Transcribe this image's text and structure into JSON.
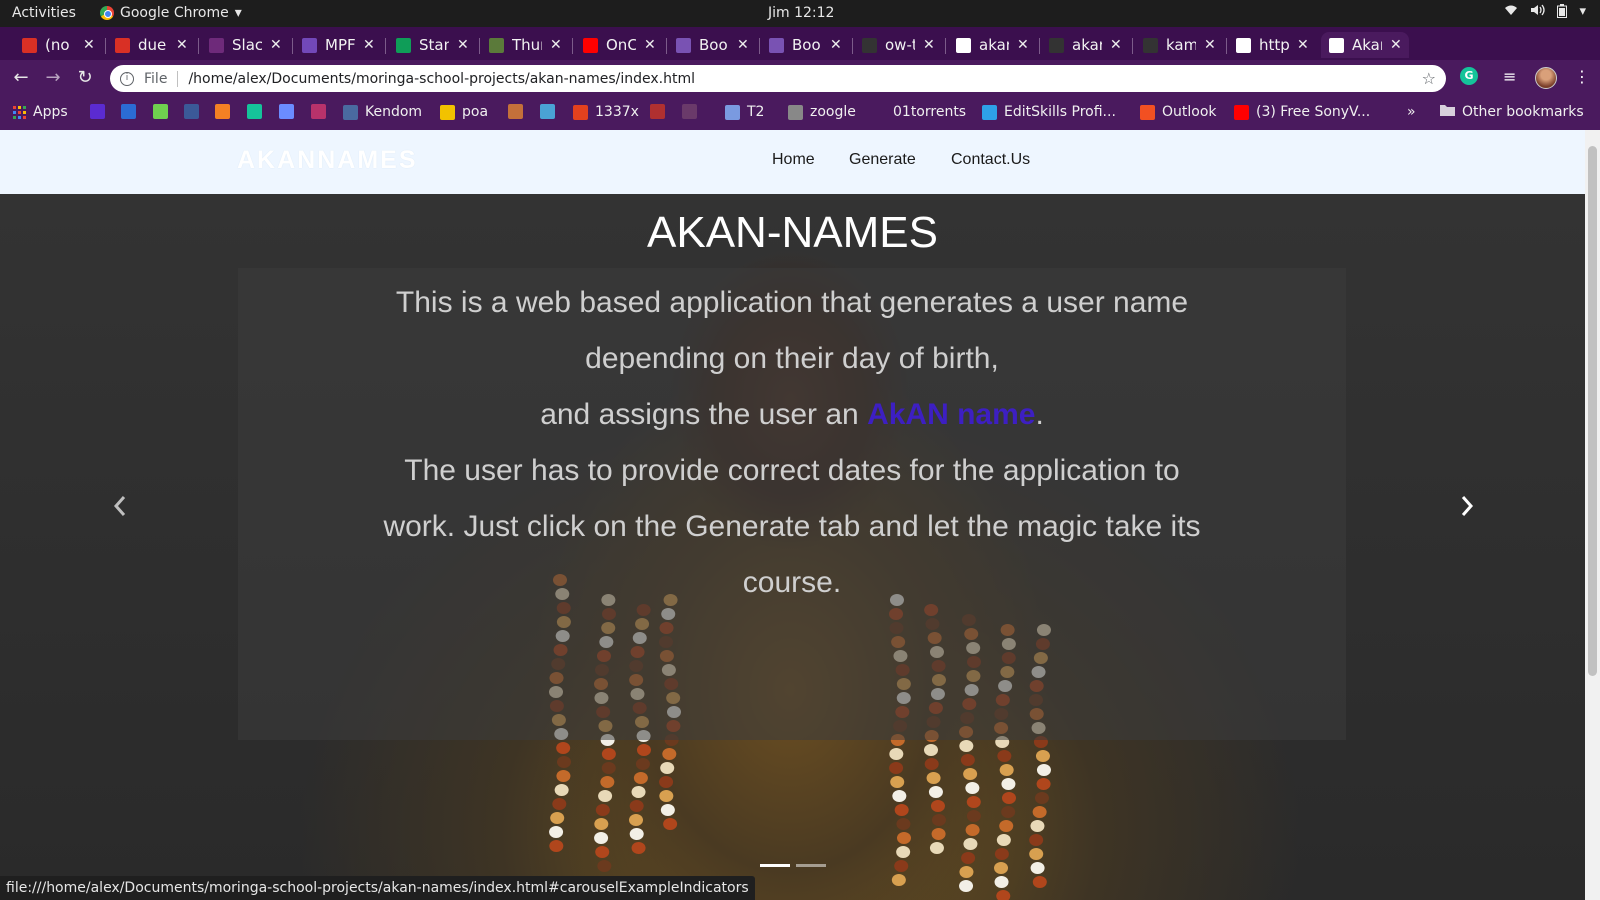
{
  "gnome": {
    "activities": "Activities",
    "app_name": "Google Chrome",
    "clock": "Jim 12:12"
  },
  "tabs": [
    {
      "title": "(no s",
      "icon": "gmail-icon",
      "color": "#d93025"
    },
    {
      "title": "due",
      "icon": "gmail-icon",
      "color": "#d93025"
    },
    {
      "title": "Slack",
      "icon": "slack-icon",
      "color": "#6e2a7a"
    },
    {
      "title": "MPF",
      "icon": "form-icon",
      "color": "#7248b9"
    },
    {
      "title": "Stan",
      "icon": "sheets-icon",
      "color": "#0f9d58"
    },
    {
      "title": "Thur",
      "icon": "leaf-icon",
      "color": "#5b7a3a"
    },
    {
      "title": "OnC",
      "icon": "youtube-icon",
      "color": "#ff0000"
    },
    {
      "title": "Boo",
      "icon": "bootstrap-icon",
      "color": "#7952b3"
    },
    {
      "title": "Boo",
      "icon": "bootstrap-icon",
      "color": "#7952b3"
    },
    {
      "title": "ow-t",
      "icon": "github-icon",
      "color": "#333333"
    },
    {
      "title": "akan",
      "icon": "google-icon",
      "color": "#ffffff"
    },
    {
      "title": "akan",
      "icon": "github-icon",
      "color": "#333333"
    },
    {
      "title": "kam",
      "icon": "github-icon",
      "color": "#333333"
    },
    {
      "title": "http",
      "icon": "globe-icon",
      "color": "#ffffff"
    },
    {
      "title": "Akan",
      "icon": "globe-icon",
      "color": "#ffffff"
    }
  ],
  "toolbar": {
    "scheme": "File",
    "url": "/home/alex/Documents/moringa-school-projects/akan-names/index.html"
  },
  "bookmarks": [
    {
      "label": "Apps",
      "icon": "apps-icon"
    },
    {
      "label": "",
      "icon": "star-icon",
      "color": "#5b2bd1"
    },
    {
      "label": "",
      "icon": "paypal-icon",
      "color": "#2b6cd4"
    },
    {
      "label": "",
      "icon": "tumblr-icon",
      "color": "#6fd04f"
    },
    {
      "label": "",
      "icon": "facebook-icon",
      "color": "#3b5998"
    },
    {
      "label": "",
      "icon": "stack-icon",
      "color": "#f48024"
    },
    {
      "label": "",
      "icon": "grammarly-icon",
      "color": "#15c39a"
    },
    {
      "label": "",
      "icon": "gem-icon",
      "color": "#6b8cff"
    },
    {
      "label": "",
      "icon": "blade-icon",
      "color": "#b8326b"
    },
    {
      "label": "Kendom",
      "icon": "kendom-icon",
      "color": "#4a6aa0"
    },
    {
      "label": "poa",
      "icon": "poa-icon",
      "color": "#f2c200"
    },
    {
      "label": "",
      "icon": "bar-icon",
      "color": "#c4703a"
    },
    {
      "label": "",
      "icon": "window-icon",
      "color": "#4aa3d4"
    },
    {
      "label": "1337x",
      "icon": "x-icon",
      "color": "#e3411e"
    },
    {
      "label": "",
      "icon": "hex-icon",
      "color": "#b03030"
    },
    {
      "label": "",
      "icon": "faded-icon",
      "color": "#6a3a6a"
    },
    {
      "label": "T2",
      "icon": "t-icon",
      "color": "#7a9ae0"
    },
    {
      "label": "zoogle",
      "icon": "z-icon",
      "color": "#888888"
    },
    {
      "label": "01torrents",
      "icon": "",
      "color": ""
    },
    {
      "label": "EditSkills Profi...",
      "icon": "editskills-icon",
      "color": "#2ea1e8"
    },
    {
      "label": "Outlook",
      "icon": "microsoft-icon",
      "color": "#f25022"
    },
    {
      "label": "(3) Free SonyV...",
      "icon": "youtube-icon",
      "color": "#ff0000"
    }
  ],
  "bookmarks_overflow": "»",
  "other_bookmarks": "Other bookmarks",
  "site": {
    "brand": "AKANNAMES",
    "nav": [
      "Home",
      "Generate",
      "Contact.Us"
    ],
    "hero_title": "AKAN-NAMES",
    "caption_lines": [
      "This is a web based application that generates a user name",
      "depending on their day of birth,",
      "and assigns the user an ",
      "AkAN name",
      ".",
      "The user has to provide correct dates for the application to",
      "work. Just click on the Generate tab and let the magic take its",
      "course."
    ],
    "carousel_prev": "‹",
    "carousel_next": "›",
    "slides": 2,
    "active_slide": 1,
    "highlight_color": "#3d1fc2"
  },
  "status_url": "file:///home/alex/Documents/moringa-school-projects/akan-names/index.html#carouselExampleIndicators"
}
